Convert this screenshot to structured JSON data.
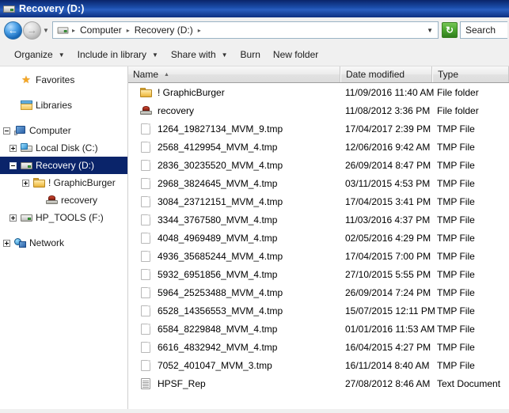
{
  "window": {
    "title": "Recovery (D:)",
    "title_icon": "drive-icon"
  },
  "navigation": {
    "back_label": "←",
    "back_name": "back-button",
    "forward_label": "→",
    "forward_name": "forward-button",
    "history_dropdown": "▼",
    "refresh_label": "↻",
    "address_dropdown": "▼",
    "breadcrumb": [
      {
        "label": "Computer"
      },
      {
        "label": "Recovery (D:)"
      }
    ],
    "separator": "▸"
  },
  "search": {
    "text": "Search"
  },
  "toolbar": {
    "items": [
      {
        "label": "Organize",
        "caret": "▼",
        "has_caret": true
      },
      {
        "label": "Include in library",
        "caret": "▼",
        "has_caret": true
      },
      {
        "label": "Share with",
        "caret": "▼",
        "has_caret": true
      },
      {
        "label": "Burn",
        "caret": "",
        "has_caret": false
      },
      {
        "label": "New folder",
        "caret": "",
        "has_caret": false
      }
    ]
  },
  "sidebar": {
    "items": [
      {
        "label": "Favorites",
        "icon": "star-icon",
        "indent": 1,
        "twist": "none",
        "selected": false,
        "gap": false
      },
      {
        "label": "Libraries",
        "icon": "libraries-icon",
        "indent": 1,
        "twist": "none",
        "selected": false,
        "gap": true
      },
      {
        "label": "Computer",
        "icon": "computer-icon",
        "indent": 0,
        "twist": "minus",
        "selected": false,
        "gap": true
      },
      {
        "label": "Local Disk (C:)",
        "icon": "local-disk-icon",
        "indent": 1,
        "twist": "plus",
        "selected": false,
        "gap": false
      },
      {
        "label": "Recovery (D:)",
        "icon": "drive-icon",
        "indent": 1,
        "twist": "minus",
        "selected": true,
        "gap": false
      },
      {
        "label": "! GraphicBurger",
        "icon": "folder-icon",
        "indent": 2,
        "twist": "plus",
        "selected": false,
        "gap": false
      },
      {
        "label": "recovery",
        "icon": "recovery-icon",
        "indent": 3,
        "twist": "none",
        "selected": false,
        "gap": false
      },
      {
        "label": "HP_TOOLS (F:)",
        "icon": "drive-icon",
        "indent": 1,
        "twist": "plus",
        "selected": false,
        "gap": false
      },
      {
        "label": "Network",
        "icon": "network-icon",
        "indent": 0,
        "twist": "plus",
        "selected": false,
        "gap": true
      }
    ]
  },
  "filelist": {
    "columns": [
      {
        "label": "Name",
        "sorted": true,
        "sort_arrow": "▲"
      },
      {
        "label": "Date modified",
        "sorted": false,
        "sort_arrow": ""
      },
      {
        "label": "Type",
        "sorted": false,
        "sort_arrow": ""
      }
    ],
    "rows": [
      {
        "name": "! GraphicBurger",
        "date": "11/09/2016 11:40 AM",
        "type": "File folder",
        "icon": "folder-icon"
      },
      {
        "name": "recovery",
        "date": "11/08/2012 3:36 PM",
        "type": "File folder",
        "icon": "recovery-icon"
      },
      {
        "name": "1264_19827134_MVM_9.tmp",
        "date": "17/04/2017 2:39 PM",
        "type": "TMP File",
        "icon": "document-icon"
      },
      {
        "name": "2568_4129954_MVM_4.tmp",
        "date": "12/06/2016 9:42 AM",
        "type": "TMP File",
        "icon": "document-icon"
      },
      {
        "name": "2836_30235520_MVM_4.tmp",
        "date": "26/09/2014 8:47 PM",
        "type": "TMP File",
        "icon": "document-icon"
      },
      {
        "name": "2968_3824645_MVM_4.tmp",
        "date": "03/11/2015 4:53 PM",
        "type": "TMP File",
        "icon": "document-icon"
      },
      {
        "name": "3084_23712151_MVM_4.tmp",
        "date": "17/04/2015 3:41 PM",
        "type": "TMP File",
        "icon": "document-icon"
      },
      {
        "name": "3344_3767580_MVM_4.tmp",
        "date": "11/03/2016 4:37 PM",
        "type": "TMP File",
        "icon": "document-icon"
      },
      {
        "name": "4048_4969489_MVM_4.tmp",
        "date": "02/05/2016 4:29 PM",
        "type": "TMP File",
        "icon": "document-icon"
      },
      {
        "name": "4936_35685244_MVM_4.tmp",
        "date": "17/04/2015 7:00 PM",
        "type": "TMP File",
        "icon": "document-icon"
      },
      {
        "name": "5932_6951856_MVM_4.tmp",
        "date": "27/10/2015 5:55 PM",
        "type": "TMP File",
        "icon": "document-icon"
      },
      {
        "name": "5964_25253488_MVM_4.tmp",
        "date": "26/09/2014 7:24 PM",
        "type": "TMP File",
        "icon": "document-icon"
      },
      {
        "name": "6528_14356553_MVM_4.tmp",
        "date": "15/07/2015 12:11 PM",
        "type": "TMP File",
        "icon": "document-icon"
      },
      {
        "name": "6584_8229848_MVM_4.tmp",
        "date": "01/01/2016 11:53 AM",
        "type": "TMP File",
        "icon": "document-icon"
      },
      {
        "name": "6616_4832942_MVM_4.tmp",
        "date": "16/04/2015 4:27 PM",
        "type": "TMP File",
        "icon": "document-icon"
      },
      {
        "name": "7052_401047_MVM_3.tmp",
        "date": "16/11/2014 8:40 AM",
        "type": "TMP File",
        "icon": "document-icon"
      },
      {
        "name": "HPSF_Rep",
        "date": "27/08/2012 8:46 AM",
        "type": "Text Document",
        "icon": "text-document-icon"
      }
    ]
  },
  "colors": {
    "titlebar_start": "#0a246a",
    "titlebar_end": "#2a5fc0",
    "selection": "#0a246a",
    "chrome": "#f0f0f0",
    "refresh_green": "#4aa52e",
    "folder_yellow": "#f7cf6a"
  }
}
